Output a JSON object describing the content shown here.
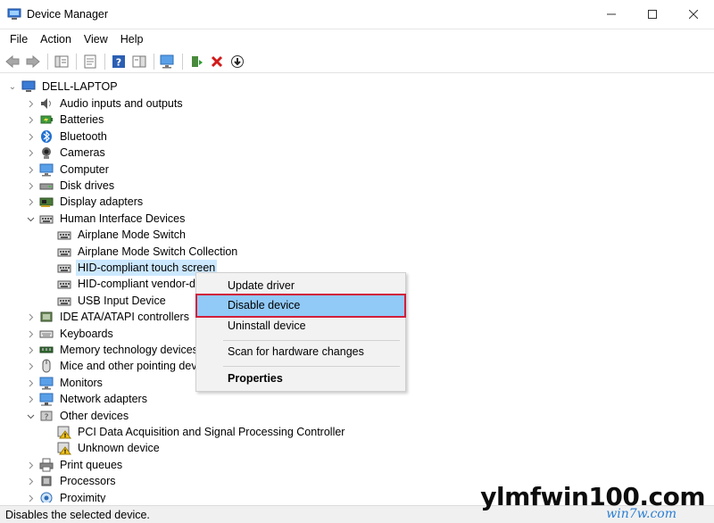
{
  "window": {
    "title": "Device Manager"
  },
  "menu": [
    "File",
    "Action",
    "View",
    "Help"
  ],
  "tree": {
    "root": "DELL-LAPTOP",
    "items": [
      {
        "label": "Audio inputs and outputs",
        "icon": "speaker-icon",
        "state": "collapsed"
      },
      {
        "label": "Batteries",
        "icon": "battery-icon",
        "state": "collapsed"
      },
      {
        "label": "Bluetooth",
        "icon": "bluetooth-icon",
        "state": "collapsed"
      },
      {
        "label": "Cameras",
        "icon": "camera-icon",
        "state": "collapsed"
      },
      {
        "label": "Computer",
        "icon": "monitor-icon",
        "state": "collapsed"
      },
      {
        "label": "Disk drives",
        "icon": "disk-icon",
        "state": "collapsed"
      },
      {
        "label": "Display adapters",
        "icon": "display-adapter-icon",
        "state": "collapsed"
      },
      {
        "label": "Human Interface Devices",
        "icon": "hid-icon",
        "state": "expanded"
      },
      {
        "label": "Airplane Mode Switch",
        "icon": "hid-icon",
        "child": true
      },
      {
        "label": "Airplane Mode Switch Collection",
        "icon": "hid-icon",
        "child": true
      },
      {
        "label": "HID-compliant touch screen",
        "icon": "hid-icon",
        "child": true,
        "selected": true
      },
      {
        "label": "HID-compliant vendor-de",
        "icon": "hid-icon",
        "child": true
      },
      {
        "label": "USB Input Device",
        "icon": "hid-icon",
        "child": true
      },
      {
        "label": "IDE ATA/ATAPI controllers",
        "icon": "ide-icon",
        "state": "collapsed"
      },
      {
        "label": "Keyboards",
        "icon": "keyboard-icon",
        "state": "collapsed"
      },
      {
        "label": "Memory technology devices",
        "icon": "memory-icon",
        "state": "collapsed"
      },
      {
        "label": "Mice and other pointing dev",
        "icon": "mouse-icon",
        "state": "collapsed"
      },
      {
        "label": "Monitors",
        "icon": "monitor-icon",
        "state": "collapsed"
      },
      {
        "label": "Network adapters",
        "icon": "network-icon",
        "state": "collapsed"
      },
      {
        "label": "Other devices",
        "icon": "other-devices-icon",
        "state": "expanded"
      },
      {
        "label": "PCI Data Acquisition and Signal Processing Controller",
        "icon": "warning-device-icon",
        "child": true
      },
      {
        "label": "Unknown device",
        "icon": "warning-device-icon",
        "child": true
      },
      {
        "label": "Print queues",
        "icon": "printer-icon",
        "state": "collapsed"
      },
      {
        "label": "Processors",
        "icon": "processor-icon",
        "state": "collapsed"
      },
      {
        "label": "Proximity",
        "icon": "proximity-icon",
        "state": "collapsed"
      }
    ]
  },
  "context_menu": {
    "update": "Update driver",
    "disable": "Disable device",
    "uninstall": "Uninstall device",
    "scan": "Scan for hardware changes",
    "properties": "Properties"
  },
  "status": "Disables the selected device.",
  "watermark": {
    "main": "ylmfwin100.com",
    "sub": "win7w.com"
  },
  "colors": {
    "selection": "#cce8ff",
    "menu_highlight": "#91c9f7",
    "highlight_outline": "#d11f3a"
  }
}
